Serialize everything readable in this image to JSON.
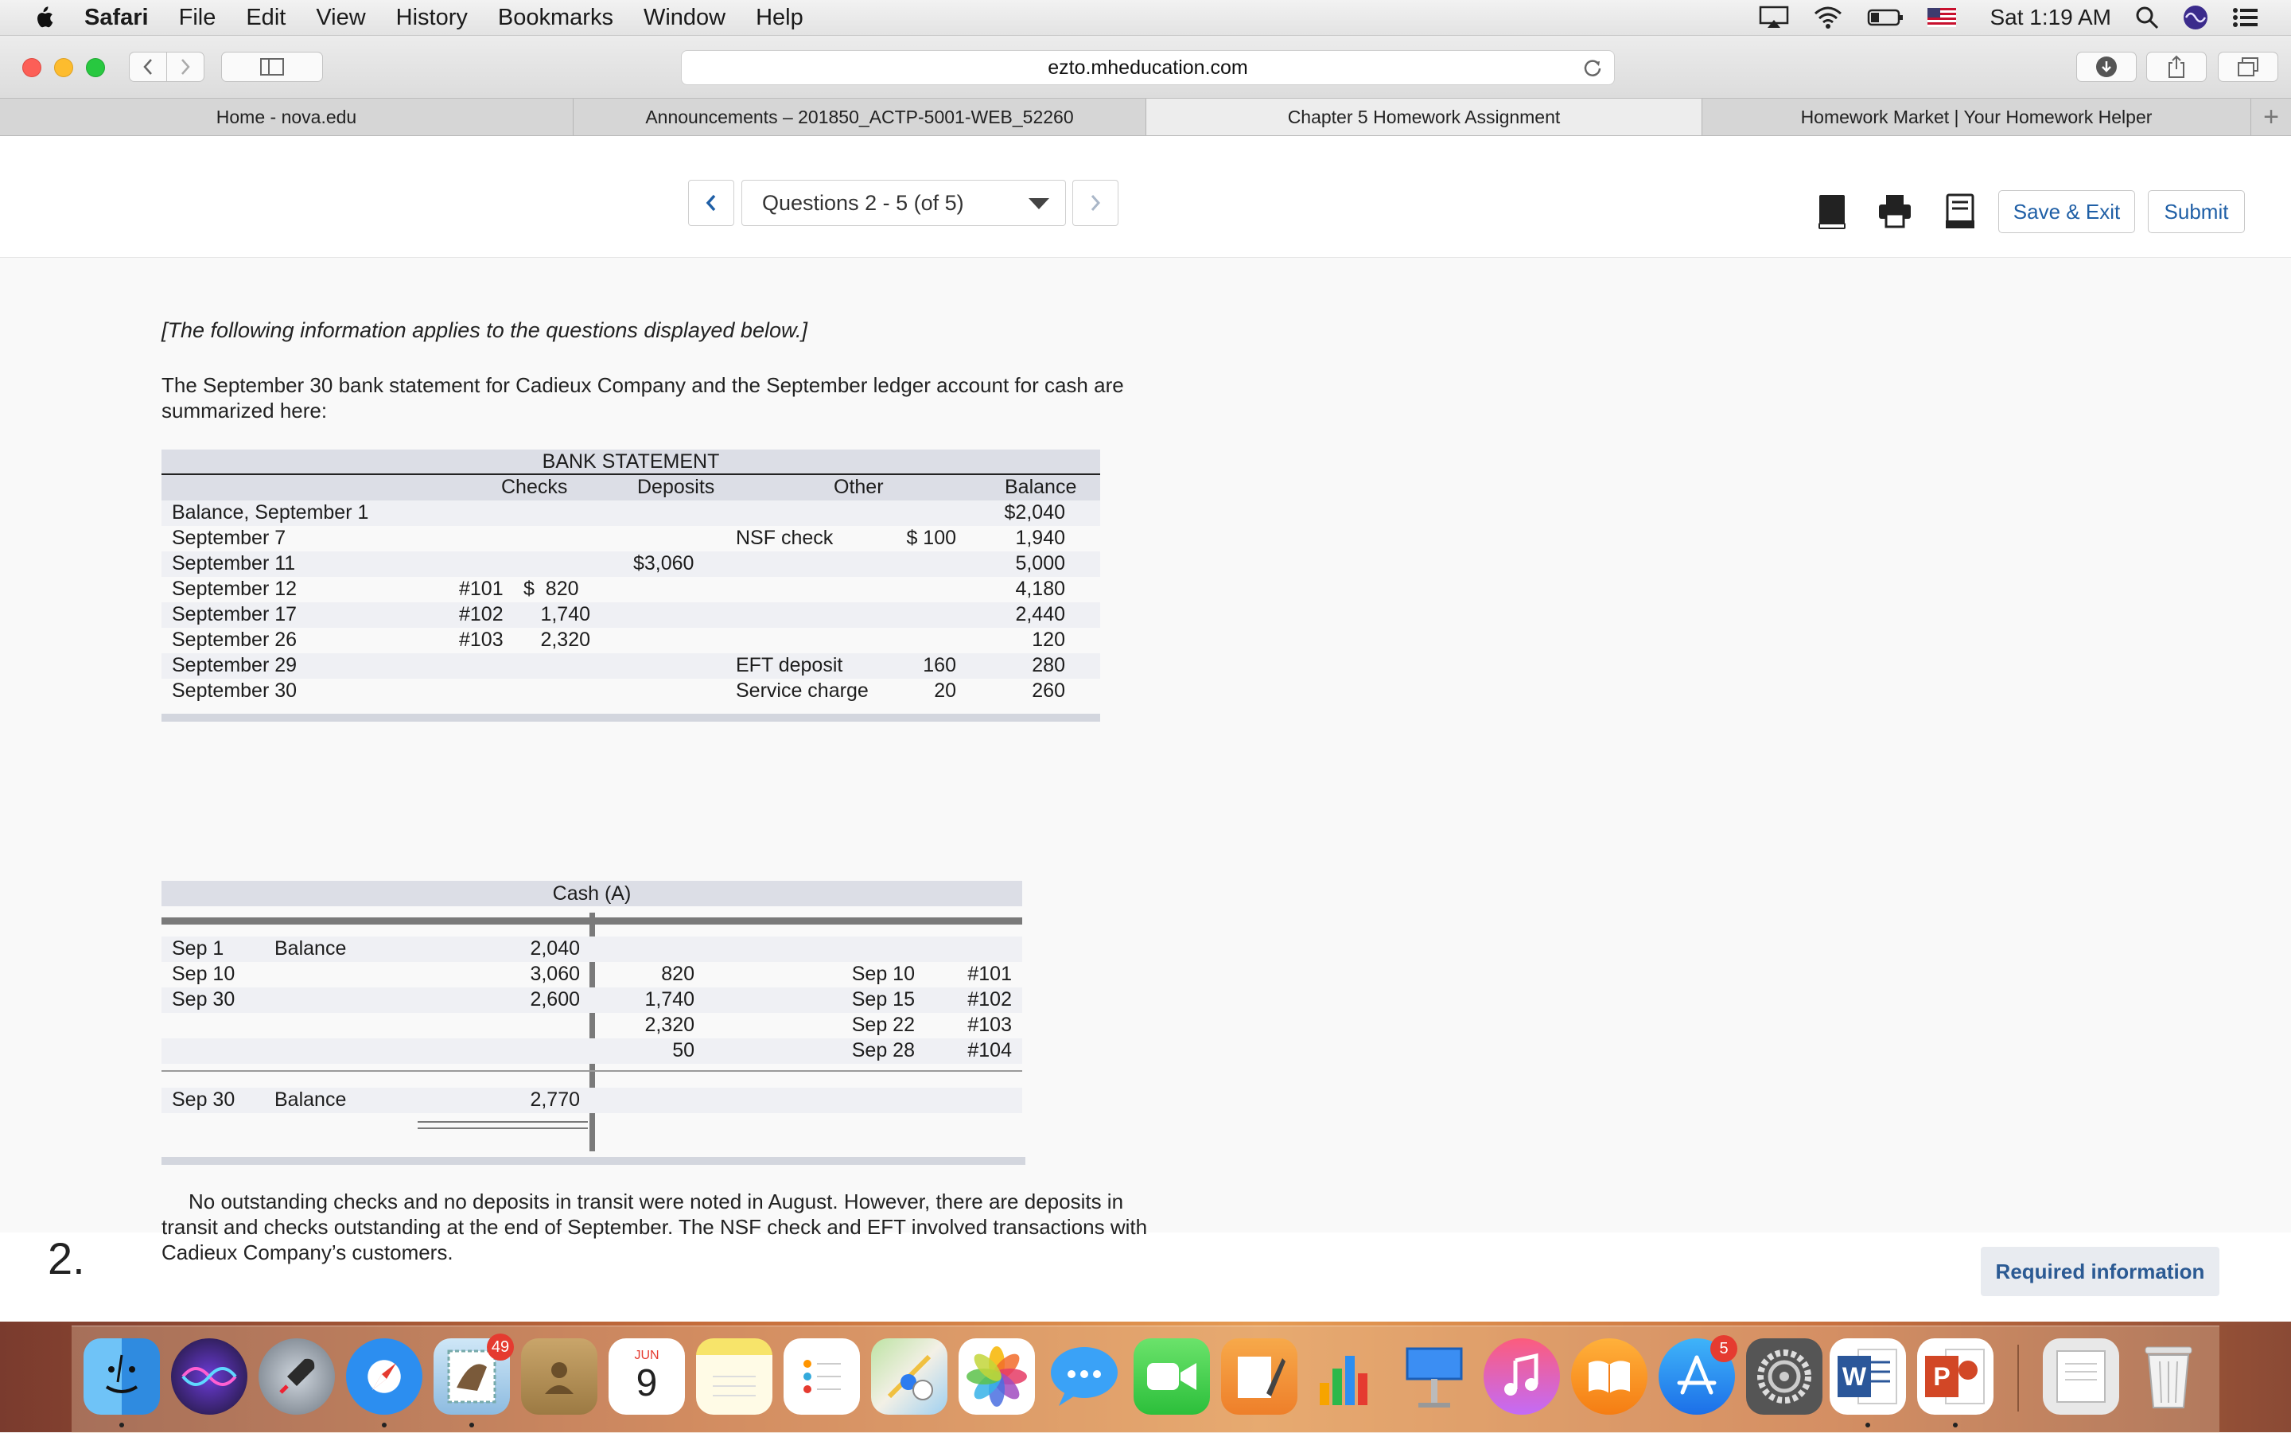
{
  "menubar": {
    "app": "Safari",
    "items": [
      "File",
      "Edit",
      "View",
      "History",
      "Bookmarks",
      "Window",
      "Help"
    ],
    "clock": "Sat 1:19 AM"
  },
  "browser": {
    "url": "ezto.mheducation.com",
    "tabs": [
      {
        "label": "Home - nova.edu",
        "active": false
      },
      {
        "label": "Announcements – 201850_ACTP-5001-WEB_52260",
        "active": false
      },
      {
        "label": "Chapter 5 Homework Assignment",
        "active": true
      },
      {
        "label": "Homework Market | Your Homework Helper",
        "active": false
      }
    ],
    "new_tab": "+"
  },
  "header": {
    "question_select": "Questions 2 - 5 (of 5)",
    "save_exit": "Save & Exit",
    "submit": "Submit"
  },
  "problem": {
    "intro": "[The following information applies to the questions displayed below.]",
    "description": "The September 30 bank statement for Cadieux Company and the September ledger account for cash are summarized here:",
    "bank_statement": {
      "title": "BANK STATEMENT",
      "headers": {
        "checks": "Checks",
        "deposits": "Deposits",
        "other": "Other",
        "balance": "Balance"
      },
      "rows": [
        {
          "label": "Balance, September 1",
          "chk_no": "",
          "chk_amt": "",
          "deposit": "",
          "other_label": "",
          "other_amt": "",
          "balance": "$2,040"
        },
        {
          "label": "September 7",
          "chk_no": "",
          "chk_amt": "",
          "deposit": "",
          "other_label": "NSF check",
          "other_amt": "$ 100",
          "balance": "1,940"
        },
        {
          "label": "September 11",
          "chk_no": "",
          "chk_amt": "",
          "deposit": "$3,060",
          "other_label": "",
          "other_amt": "",
          "balance": "5,000"
        },
        {
          "label": "September 12",
          "chk_no": "#101",
          "chk_amt": "$  820",
          "deposit": "",
          "other_label": "",
          "other_amt": "",
          "balance": "4,180"
        },
        {
          "label": "September 17",
          "chk_no": "#102",
          "chk_amt": "1,740",
          "deposit": "",
          "other_label": "",
          "other_amt": "",
          "balance": "2,440"
        },
        {
          "label": "September 26",
          "chk_no": "#103",
          "chk_amt": "2,320",
          "deposit": "",
          "other_label": "",
          "other_amt": "",
          "balance": "120"
        },
        {
          "label": "September 29",
          "chk_no": "",
          "chk_amt": "",
          "deposit": "",
          "other_label": "EFT deposit",
          "other_amt": "160",
          "balance": "280"
        },
        {
          "label": "September 30",
          "chk_no": "",
          "chk_amt": "",
          "deposit": "",
          "other_label": "Service charge",
          "other_amt": "20",
          "balance": "260"
        }
      ]
    },
    "cash_account": {
      "title": "Cash (A)",
      "rows": [
        {
          "date": "Sep 1",
          "desc": "Balance",
          "debit": "2,040",
          "credit": "",
          "cdate": "",
          "ref": ""
        },
        {
          "date": "Sep 10",
          "desc": "",
          "debit": "3,060",
          "credit": "820",
          "cdate": "Sep 10",
          "ref": "#101"
        },
        {
          "date": "Sep 30",
          "desc": "",
          "debit": "2,600",
          "credit": "1,740",
          "cdate": "Sep 15",
          "ref": "#102"
        },
        {
          "date": "",
          "desc": "",
          "debit": "",
          "credit": "2,320",
          "cdate": "Sep 22",
          "ref": "#103"
        },
        {
          "date": "",
          "desc": "",
          "debit": "",
          "credit": "50",
          "cdate": "Sep 28",
          "ref": "#104"
        }
      ],
      "ending": {
        "date": "Sep 30",
        "desc": "Balance",
        "debit": "2,770"
      }
    },
    "note": "No outstanding checks and no deposits in transit were noted in August. However, there are deposits in transit and checks outstanding at the end of September. The NSF check and EFT involved transactions with Cadieux Company’s customers."
  },
  "question": {
    "number": "2.",
    "required_label": "Required information"
  },
  "dock": {
    "badges": {
      "mail": "49",
      "appstore": "5",
      "calendar_month": "JUN",
      "calendar_day": "9"
    }
  }
}
